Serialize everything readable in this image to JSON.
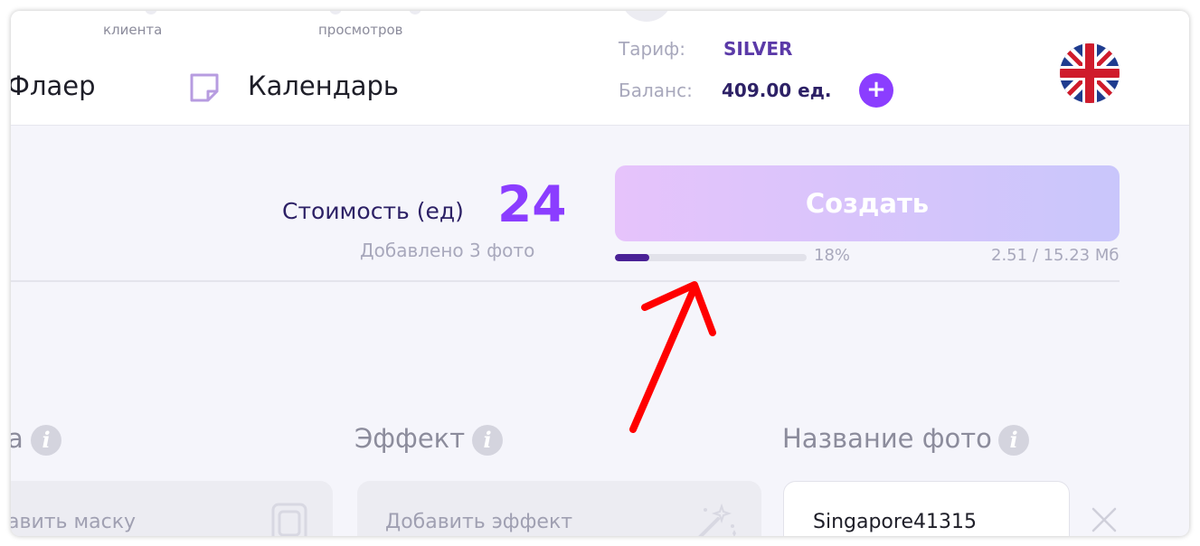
{
  "header": {
    "top_labels": [
      "клиента",
      "просмотров"
    ],
    "nav": [
      {
        "label": "Флаер"
      },
      {
        "label": "Календарь",
        "icon": "sticky-note-icon"
      }
    ],
    "tariff_label": "Тариф:",
    "tariff_value": "SILVER",
    "balance_label": "Баланс:",
    "balance_value": "409.00 ед.",
    "add_balance_icon": "plus-icon",
    "add_balance_symbol": "+",
    "language_flag": "uk-flag-icon"
  },
  "cost": {
    "label": "Стоимость (ед)",
    "value": "24",
    "photos_added": "Добавлено 3 фото"
  },
  "create_button": {
    "label": "Создать"
  },
  "upload": {
    "progress_percent": 18,
    "progress_text": "18%",
    "size_text": "2.51 / 15.23 Мб"
  },
  "fields": {
    "mask": {
      "label_partial": "а",
      "placeholder_partial": "авить маску",
      "icon": "mask-frame-icon"
    },
    "effect": {
      "label": "Эффект",
      "placeholder": "Добавить эффект",
      "icon": "magic-wand-icon"
    },
    "photo_name": {
      "label": "Название фото",
      "value": "Singapore41315",
      "clear_icon": "close-icon"
    },
    "info_symbol": "i"
  },
  "annotation": {
    "arrow_color": "#ff0000",
    "target": "upload-progress-bar"
  },
  "colors": {
    "accent": "#8b3dff",
    "dark_text": "#2d2166",
    "muted_text": "#a8a8bc",
    "progress_fill": "#4a2196",
    "button_gradient_start": "#e6c3fb",
    "button_gradient_end": "#c9c6fb"
  }
}
